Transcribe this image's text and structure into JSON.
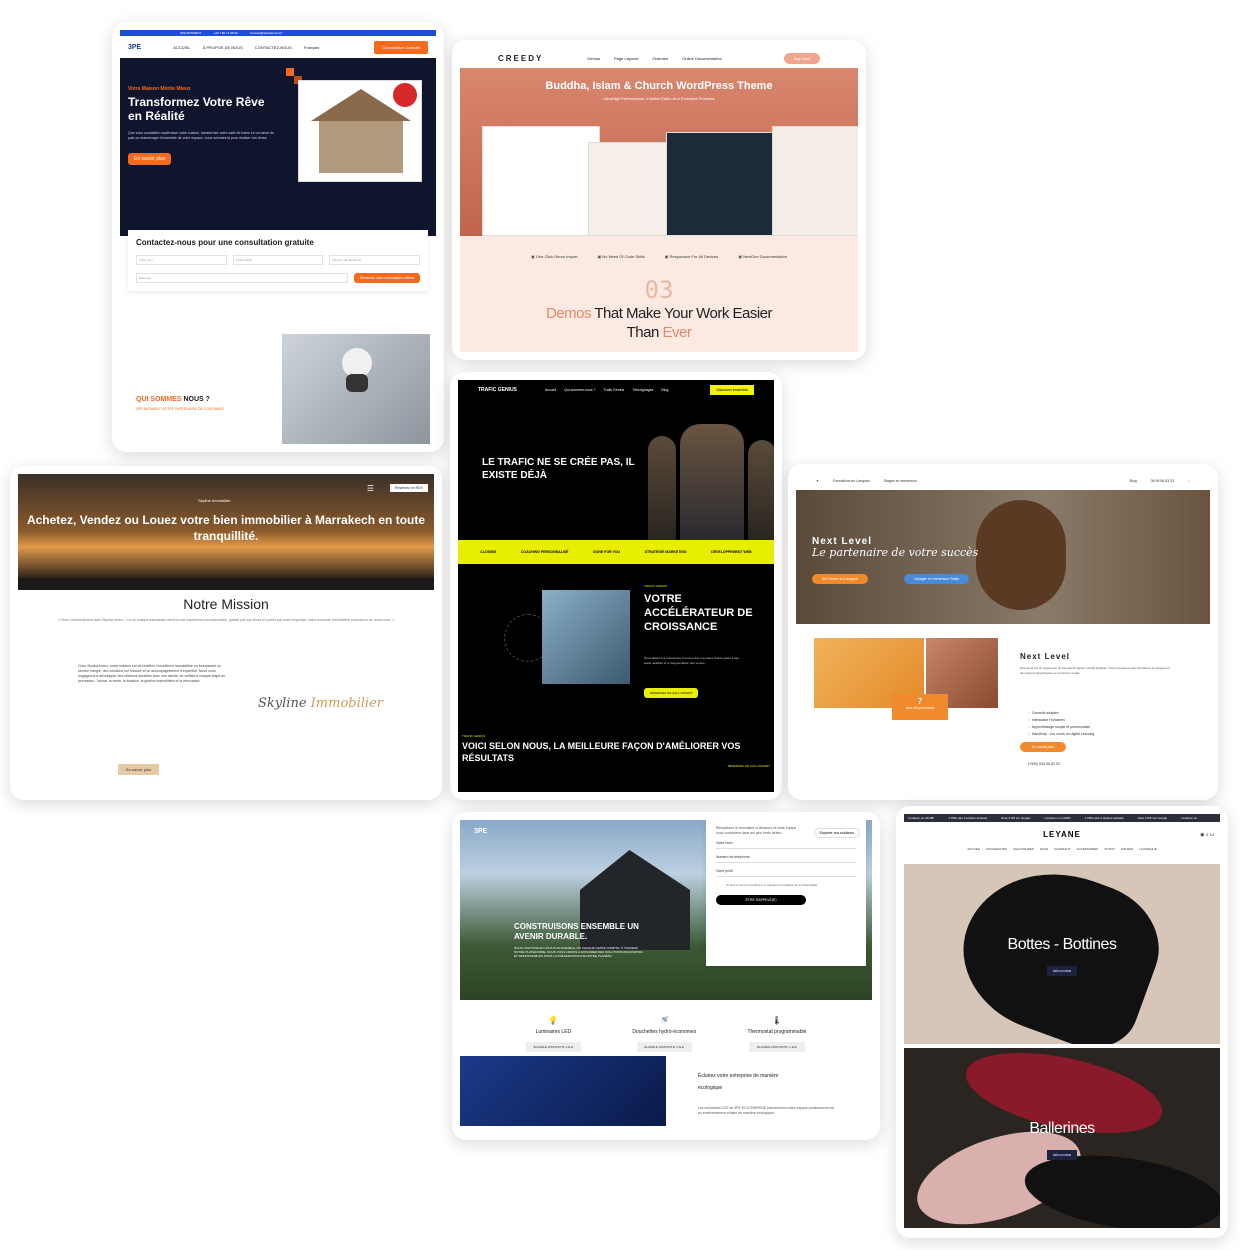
{
  "colors": {
    "orange": "#f56a1d",
    "navy": "#10152e",
    "yellow": "#e7ee00",
    "peach": "#fbe9e2"
  },
  "card1": {
    "topbar": [
      "3PE BATIMENT",
      "+33 7 80 71 55 90",
      "Contact@3pebatiment.fr"
    ],
    "logo": "3PE",
    "nav": [
      "ACCUEIL",
      "À PROPOS DE NOUS",
      "CONTACTEZ-NOUS"
    ],
    "language": "Français",
    "cta": "Consultation Gratuite",
    "kicker": "Votre Maison Mérite Mieux",
    "title": "Transformez Votre Rêve en Réalité",
    "text": "Que vous souhaitiez moderniser votre cuisine, transformer votre salle de bains en un havre de paix ou réaménager l'ensemble de votre espace, nous sommes là pour réaliser vos rêves.",
    "button": "En savoir plus",
    "contact_title": "Contactez-nous pour une consultation gratuite",
    "fields": [
      "Votre nom",
      "Code postal",
      "Numéro de téléphone",
      "Message"
    ],
    "submit": "Réservez votre consultation offerte",
    "who_title_1": "QUI SOMMES",
    "who_title_2": "NOUS ?",
    "who_sub": "3PE BATIMENT VOTRE PARTENAIRE DE CONFIANCE"
  },
  "card2": {
    "logo": "CREEDY",
    "nav": [
      "Demos",
      "Page Layouts",
      "Features",
      "Online Documentation"
    ],
    "buy": "Buy Now",
    "title": "Buddha, Islam & Church WordPress Theme",
    "subtitle": "UltraHigh Performance, Intuitive Editor And Exclusive Features",
    "features": [
      "One Click Demo Import",
      "No Need Of Code Skills",
      "Responsive For All Devices",
      "NextGen Documentation"
    ],
    "count": "03",
    "demos_1": "Demos",
    "demos_2": "That Make Your Work Easier",
    "demos_3": "Than",
    "demos_4": "Ever"
  },
  "card3": {
    "logo": "TRAFIC GENIUS",
    "nav": [
      "Accueil",
      "Qui sommes-nous ?",
      "Trafic Genius",
      "Témoignages",
      "Blog"
    ],
    "cta": "Discutons ensemble",
    "hero": "LE TRAFIC NE SE CRÉE PAS, IL EXISTE DÉJÀ",
    "band": [
      "CLOSING",
      "COACHING PERSONNALISÉ",
      "DONE FOR YOU",
      "STRATÉGIE MARKETING",
      "DÉVELOPPEMENT WEB"
    ],
    "kicker": "TRAFIC GENIUS",
    "acc_title": "VOTRE ACCÉLÉRATEUR DE CROISSANCE",
    "acc_text": "Nous aidons les entreprises à trouver des nouveaux clients grâce à des leads qualifiés et à l'augmentation des ventes.",
    "acc_button": "RÉSERVEZ UN CALL OFFERT",
    "foot_kicker": "TRAFIC GENIUS",
    "foot_title": "VOICI SELON NOUS, LA MEILLEURE FAÇON D'AMÉLIORER VOS RÉSULTATS",
    "foot_cta": "RÉSERVEZ UN CALL OFFERT"
  },
  "card4": {
    "brand": "Skyline Immobilier",
    "rdv": "Réservez en RDV",
    "title": "Achetez, Vendez ou Louez votre bien immobilier à Marrakech en toute tranquillité.",
    "mission": "Notre Mission",
    "quote": "« Chez l'extraordinaire avec Skyline Immo – Là où chaque transaction devient une expérience exceptionnelle, guidée par vos rêves et portée par notre expertise. Votre aventure immobilière commence ici, avec nous. »",
    "text": "Chez Skyline Immo, notre mission est de redéfinir l'excellence immobilière en fournissant un service intégré, des solutions sur mesure et un accompagnement d'expertise. Nous nous engageons à développer des relations durables avec nos clients, en veillant à chaque étape du processus : l'achat, la vente, la location, la gestion immobilière et la rénovation.",
    "sig_1": "Skyline",
    "sig_2": "Immobilier",
    "readmore": "En savoir plus"
  },
  "card5": {
    "nav": [
      "Formations en Langues",
      "Stages en Immersion"
    ],
    "nav_right": [
      "Blog",
      "06 95 56 83 33"
    ],
    "title": "Next Level",
    "subtitle": "Le partenaire de votre succès",
    "btn1": "Se Former en Langues",
    "btn2": "Voyager en Immersion Totale",
    "exp_num": "7",
    "exp_label": "Ans d'expériences",
    "section_title": "Next Level",
    "section_text": "Next level est un organisme de formations agréé, certifié Qualiopi. Nous proposons des formations en langues et des séjours linguistiques en immersion totale.",
    "list": [
      "Conseils adaptés",
      "Interaction Humaines",
      "Apprentissage souple et personnalisé",
      "Handicap : Les cours du digital Learning"
    ],
    "more": "En savoir plus",
    "phone": "(+590) 690 56 83 33"
  },
  "card6": {
    "logo": "3PE",
    "form_intro": "Remplissez le formulaire ci-dessous et notre équipe vous contactera dans les plus brefs délais.",
    "explore": "Explorer nos solutions",
    "fields": [
      "Votre Nom",
      "Numéro de telephone",
      "Votre profil"
    ],
    "consent": "Je suis lu par les conditions et j'accepte la politique de confidentialité",
    "send": "ÊTRE RAPPELÉ(E)",
    "hero_title": "CONSTRUISONS ENSEMBLE UN AVENIR DURABLE.",
    "hero_text": "NOUS CROYONS EN UN FUTUR DURABLE, OÙ CHAQUE GESTE COMPTE. À TRAVERS NOTRE PLATEFORME, NOUS VOUS AIDONS À EXPLORER DES SOLUTIONS INNOVANTES ET RESPONSABLES POUR LA PRÉSERVATION DE NOTRE PLANÈTE.",
    "products": [
      {
        "name": "Luminaires LED",
        "elig": "ÉLIGIBLE DISPOSITIF C.E.E"
      },
      {
        "name": "Douchettes hydro-économes",
        "elig": "ÉLIGIBLE DISPOSITIF C.E.E"
      },
      {
        "name": "Thermostat programmable",
        "elig": "ÉLIGIBLE DISPOSITIF C.E.E"
      }
    ],
    "bottom_title_1": "Éclairez votre entreprise de manière",
    "bottom_title_2": "écologique",
    "bottom_text": "Les luminaires LED de 3PE ECO ÉNERGIE transforment votre espace professionnel en un environnement éclairé de manière écologique."
  },
  "card7": {
    "ticker": [
      "Livraison en 24/48h",
      "1 Offre dès 3 articles achetés",
      "Noté 4.9/5 sur Google",
      "Livraison en 24/48h",
      "1 Offre dès 3 articles achetés",
      "Noté 4.9/5 sur Google",
      "Livraison en"
    ],
    "logo": "LEYANE",
    "menu": [
      "ACCUEIL",
      "NOUVEAUTÉS",
      "CHAUSSURES",
      "SACS",
      "CHAPEAUX",
      "ACCESSOIRES",
      "OUTFIT",
      "SOLDES",
      "LA MARQUE"
    ],
    "panel1": "Bottes - Bottines",
    "panel2": "Ballerines",
    "btn": "DÉCOUVRIR"
  }
}
